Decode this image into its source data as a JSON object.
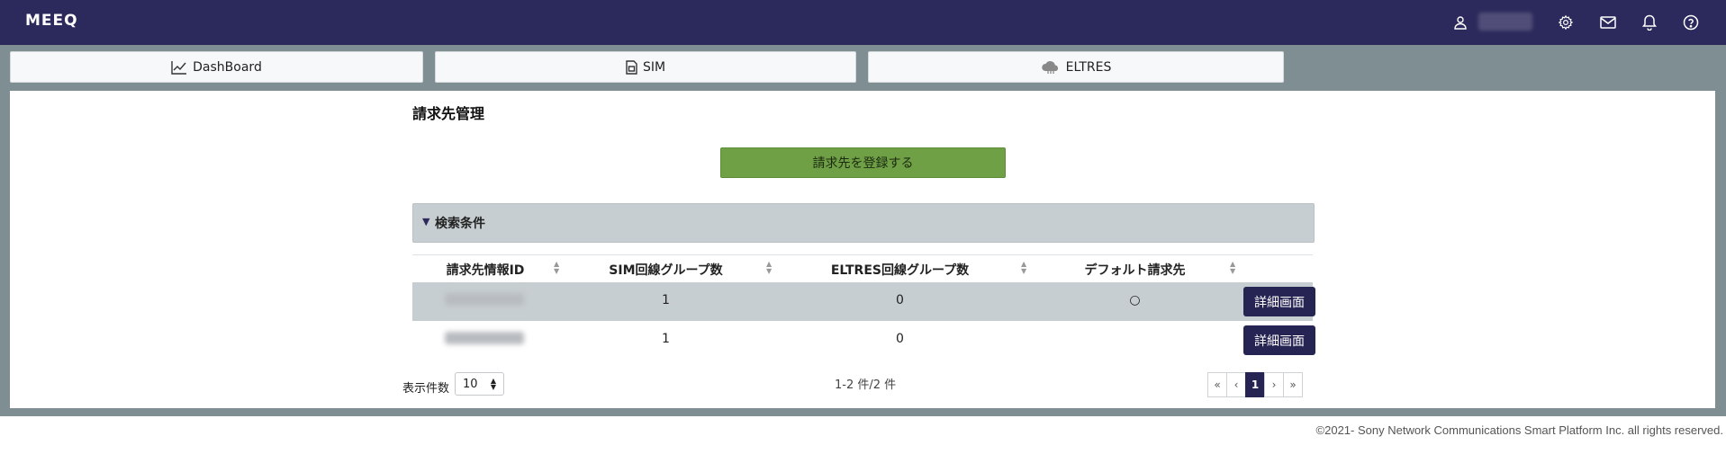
{
  "header": {
    "logo": "MEEQ",
    "icons": [
      "user-icon",
      "gear-icon",
      "mail-icon",
      "bell-icon",
      "help-icon"
    ]
  },
  "nav": {
    "tabs": [
      {
        "label": "DashBoard",
        "icon": "chart-line-icon"
      },
      {
        "label": "SIM",
        "icon": "sim-card-icon"
      },
      {
        "label": "ELTRES",
        "icon": "cloud-network-icon"
      }
    ]
  },
  "page": {
    "title": "請求先管理",
    "register_button": "請求先を登録する",
    "search_panel_label": "検索条件"
  },
  "table": {
    "columns": [
      "請求先情報ID",
      "SIM回線グループ数",
      "ELTRES回線グループ数",
      "デフォルト請求先"
    ],
    "rows": [
      {
        "sim_groups": "1",
        "eltres_groups": "0",
        "default": "○",
        "action": "詳細画面"
      },
      {
        "sim_groups": "1",
        "eltres_groups": "0",
        "default": "",
        "action": "詳細画面"
      }
    ]
  },
  "pagination": {
    "per_page_label": "表示件数",
    "per_page_value": "10",
    "count_text": "1-2 件/2 件",
    "first": "«",
    "prev": "‹",
    "current": "1",
    "next": "›",
    "last": "»"
  },
  "footer": {
    "copyright": "©2021- Sony Network Communications Smart Platform Inc. all rights reserved."
  },
  "colors": {
    "header_bg": "#2c2a5c",
    "page_bg": "#7f8e93",
    "register_button": "#6fa046",
    "detail_button": "#262452",
    "panel_bg": "#c7ced1"
  }
}
